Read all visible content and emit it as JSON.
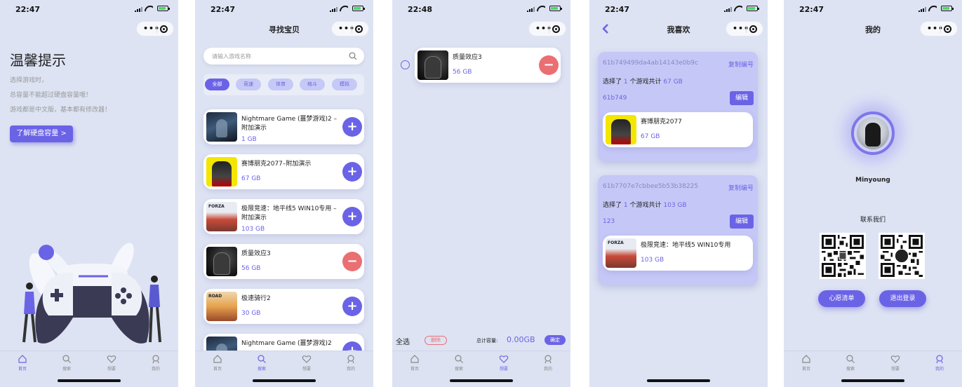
{
  "screens": [
    {
      "time": "22:47",
      "tip": {
        "title": "温馨提示",
        "lines": [
          "选择游戏时，",
          "总容量不能超过硬盘容量哦！",
          "游戏都是中文版，基本都有修改器！"
        ],
        "button": "了解硬盘容量 >"
      },
      "active_tab": 0
    },
    {
      "time": "22:47",
      "title": "寻找宝贝",
      "search_placeholder": "请输入游戏名称",
      "chips": [
        "全部",
        "竞速",
        "体育",
        "格斗",
        "模拟"
      ],
      "games": [
        {
          "title": "Nightmare Game (噩梦游戏)2 – 附加演示",
          "size": "1 GB",
          "action": "+"
        },
        {
          "title": "赛博朋克2077–附加演示",
          "size": "67 GB",
          "action": "+"
        },
        {
          "title": "极限竞速：地平线5 WIN10专用 – 附加演示",
          "size": "103 GB",
          "action": "+"
        },
        {
          "title": "质量效应3",
          "size": "56 GB",
          "action": "−"
        },
        {
          "title": "极速骑行2",
          "size": "30 GB",
          "action": "+"
        },
        {
          "title": "Nightmare Game (噩梦游戏)2",
          "size": "",
          "action": "+"
        }
      ],
      "active_tab": 1
    },
    {
      "time": "22:48",
      "cart": [
        {
          "title": "质量效应3",
          "size": "56 GB",
          "action": "−"
        }
      ],
      "footer": {
        "select_all": "全选",
        "delete": "删除",
        "capacity_label": "总计容量:",
        "capacity_value": "0.00GB",
        "confirm": "确定"
      },
      "active_tab": 2
    },
    {
      "time": "22:47",
      "title": "我喜欢",
      "orders": [
        {
          "id": "61b749499da4ab14143e0b9c",
          "copy": "复制编号",
          "sum_pre": "选择了",
          "count": "1",
          "sum_mid": "个游戏共计",
          "total": "67 GB",
          "short": "61b749",
          "edit": "编辑",
          "game": {
            "title": "赛博朋克2077",
            "size": "67 GB"
          }
        },
        {
          "id": "61b7707e7cbbee5b53b38225",
          "copy": "复制编号",
          "sum_pre": "选择了",
          "count": "1",
          "sum_mid": "个游戏共计",
          "total": "103 GB",
          "short": "123",
          "edit": "编辑",
          "game": {
            "title": "极限竞速：地平线5 WIN10专用",
            "size": "103 GB"
          }
        }
      ]
    },
    {
      "time": "22:47",
      "title": "我的",
      "username": "Minyoung",
      "contact": "联系我们",
      "buttons": [
        "心愿清单",
        "退出登录"
      ],
      "active_tab": 3
    }
  ],
  "tabs": [
    "首页",
    "搜索",
    "想要",
    "我的"
  ],
  "colors": {
    "accent": "#6b63e6",
    "minus": "#ea6f72",
    "background": "#dde3f3"
  },
  "icons": {
    "tabs": [
      "home-icon",
      "search-icon",
      "heart-icon",
      "user-icon"
    ]
  }
}
